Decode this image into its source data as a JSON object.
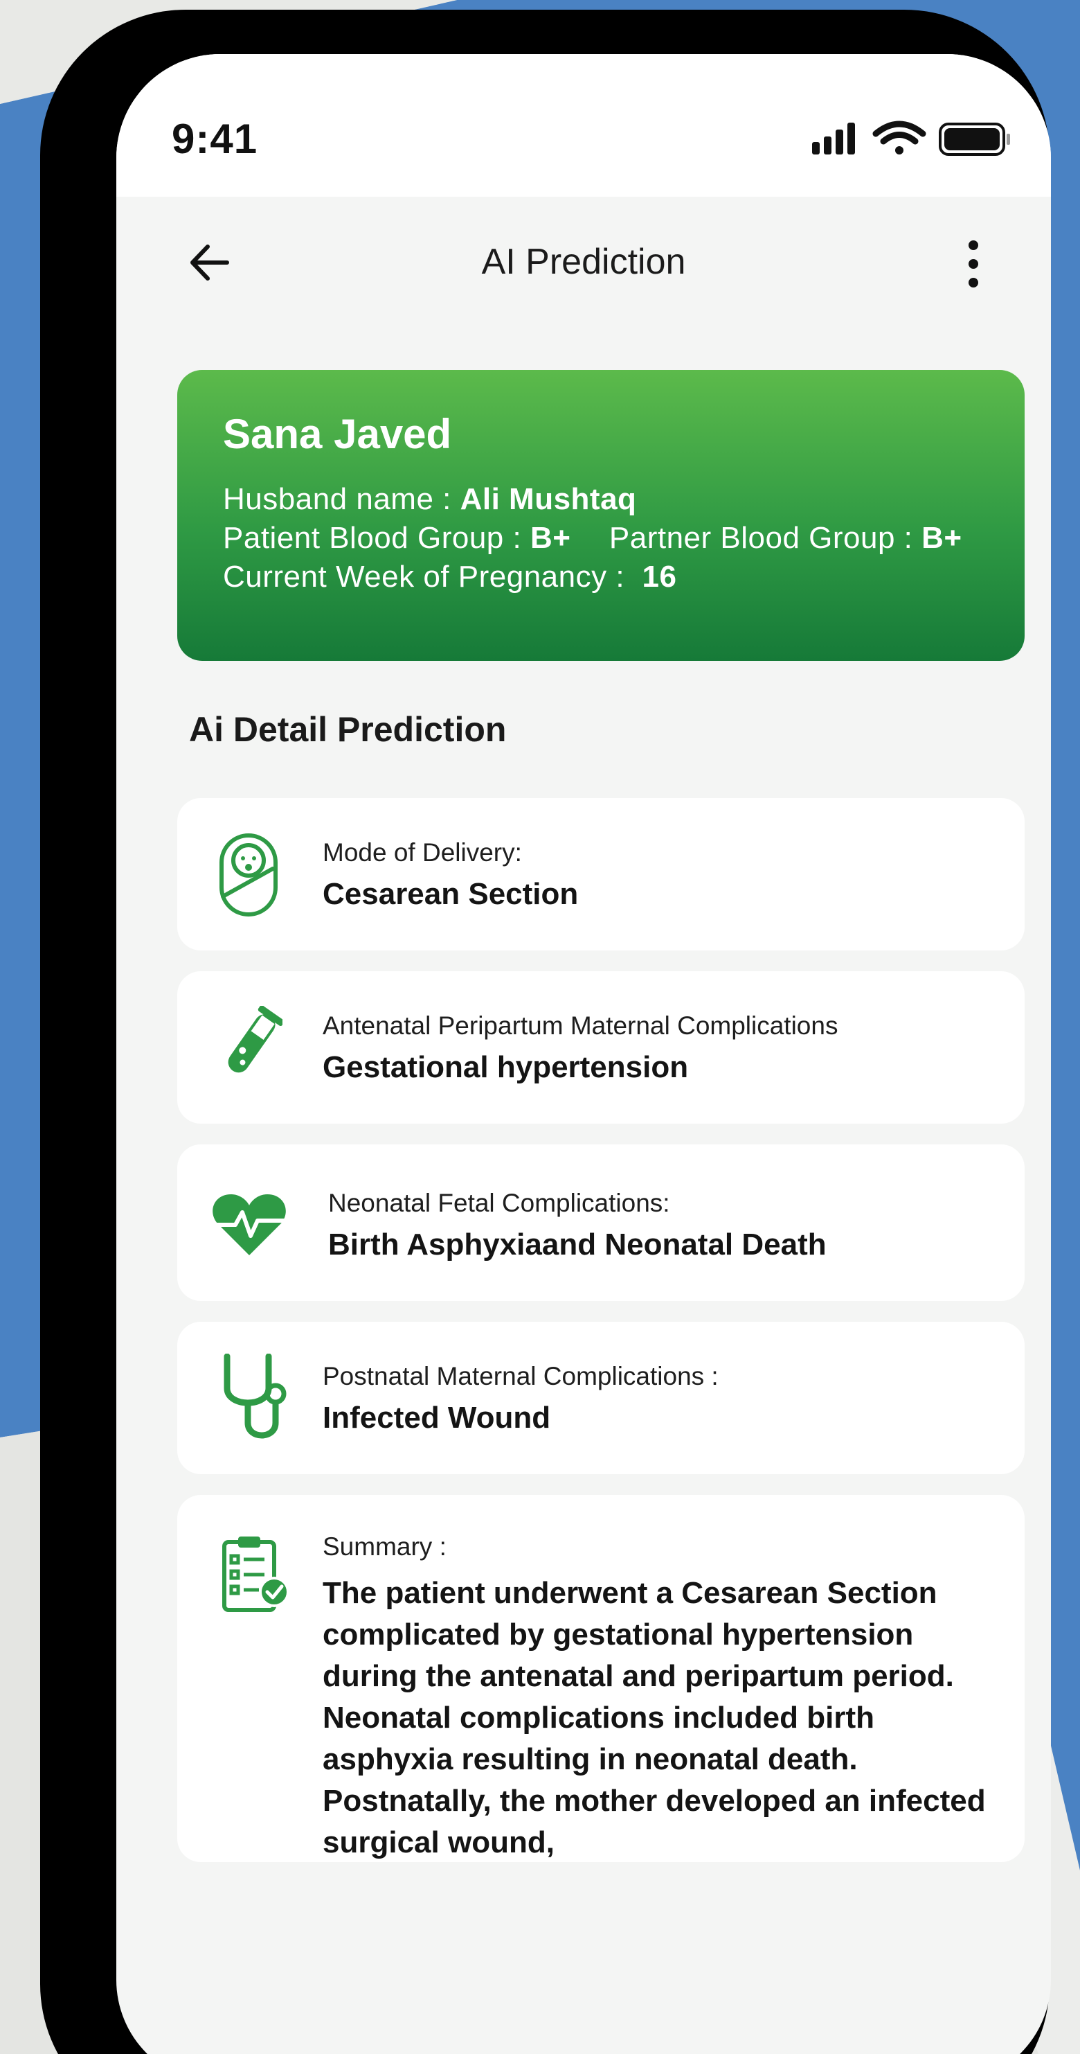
{
  "status_bar": {
    "time": "9:41"
  },
  "header": {
    "title": "AI Prediction"
  },
  "patient": {
    "name": "Sana Javed",
    "husband_label": "Husband name : ",
    "husband_value": "Ali Mushtaq",
    "patient_blood_label": "Patient Blood Group : ",
    "patient_blood_value": "B+",
    "partner_blood_label": "Partner Blood Group : ",
    "partner_blood_value": "B+",
    "week_label": "Current Week of Pregnancy :  ",
    "week_value": "16"
  },
  "section": {
    "title": "Ai Detail Prediction"
  },
  "predictions": [
    {
      "icon": "baby-icon",
      "label": "Mode of Delivery:",
      "value": "Cesarean Section"
    },
    {
      "icon": "test-tube-icon",
      "label": "Antenatal Peripartum Maternal Complications",
      "value": "Gestational hypertension"
    },
    {
      "icon": "heart-pulse-icon",
      "label": "Neonatal Fetal Complications:",
      "value": "Birth Asphyxiaand Neonatal Death"
    },
    {
      "icon": "stethoscope-icon",
      "label": "Postnatal Maternal Complications :",
      "value": "Infected Wound"
    }
  ],
  "summary": {
    "icon": "clipboard-check-icon",
    "label": "Summary :",
    "text": "The patient underwent a Cesarean Section complicated by gestational hypertension during the antenatal and peripartum period. Neonatal complications included birth asphyxia resulting in neonatal death. Postnatally, the mother developed an infected surgical wound,"
  },
  "colors": {
    "accent": "#2e9a45",
    "background_blue": "#4a82c3",
    "screen": "#f4f5f4"
  }
}
